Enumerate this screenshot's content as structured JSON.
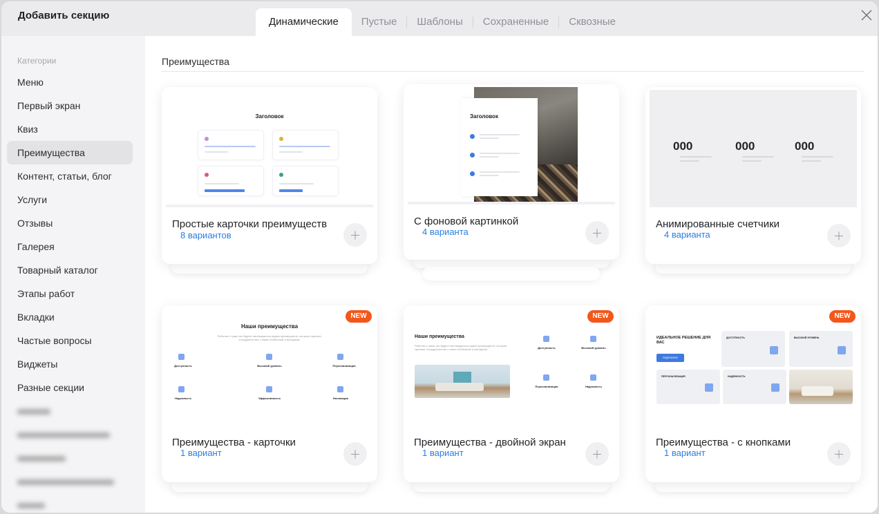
{
  "modal": {
    "title": "Добавить секцию",
    "tabs": [
      {
        "label": "Динамические",
        "active": true
      },
      {
        "label": "Пустые",
        "active": false
      },
      {
        "label": "Шаблоны",
        "active": false
      },
      {
        "label": "Сохраненные",
        "active": false
      },
      {
        "label": "Сквозные",
        "active": false
      }
    ]
  },
  "sidebar": {
    "heading": "Категории",
    "items": [
      {
        "label": "Меню"
      },
      {
        "label": "Первый экран"
      },
      {
        "label": "Квиз"
      },
      {
        "label": "Преимущества",
        "active": true
      },
      {
        "label": "Контент, статьи, блог"
      },
      {
        "label": "Услуги"
      },
      {
        "label": "Отзывы"
      },
      {
        "label": "Галерея"
      },
      {
        "label": "Товарный каталог"
      },
      {
        "label": "Этапы работ"
      },
      {
        "label": "Вкладки"
      },
      {
        "label": "Частые вопросы"
      },
      {
        "label": "Виджеты"
      },
      {
        "label": "Разные секции"
      }
    ]
  },
  "main": {
    "section_title": "Преимущества",
    "cards": [
      {
        "name": "Простые карточки преимуществ",
        "variants": "8 вариантов"
      },
      {
        "name": "С фоновой картинкой",
        "variants": "4 варианта"
      },
      {
        "name": "Анимированные счетчики",
        "variants": "4 варианта"
      },
      {
        "name": "Преимущества - карточки",
        "variants": "1 вариант",
        "badge": "NEW"
      },
      {
        "name": "Преимущества - двойной экран",
        "variants": "1 вариант",
        "badge": "NEW"
      },
      {
        "name": "Преимущества - с кнопками",
        "variants": "1 вариант",
        "badge": "NEW"
      }
    ],
    "thumbs": {
      "heading": "Заголовок",
      "counter": "000",
      "our_adv": "Наши преимущества",
      "our_adv_sub": "Работая с нами, вы будете наслаждаться рядом преимуществ, которые сделают сотрудничество с нами особенным и выгодным.",
      "adv_items": [
        "Доступность",
        "Высокий уровень",
        "Персонализация",
        "Надежность",
        "Эффективность",
        "Инновации"
      ],
      "adv_desc": "Предлагаем услуги в подходящем сегменте",
      "ideal": "ИДЕАЛЬНОЕ РЕШЕНИЕ ДЛЯ ВАС",
      "btn": "ПОДРОБНЕЕ",
      "t6_items": [
        "ДОСТУПНОСТЬ",
        "ВЫСОКИЙ УРОВЕНЬ",
        "ПЕРСОНАЛИЗАЦИЯ",
        "НАДЕЖНОСТЬ"
      ]
    }
  },
  "colors": {
    "accent": "#2a7de1",
    "badge": "#f3571a",
    "active_bg": "#e3e3e6"
  },
  "icons": {
    "close": "close-icon",
    "add": "plus-icon"
  }
}
